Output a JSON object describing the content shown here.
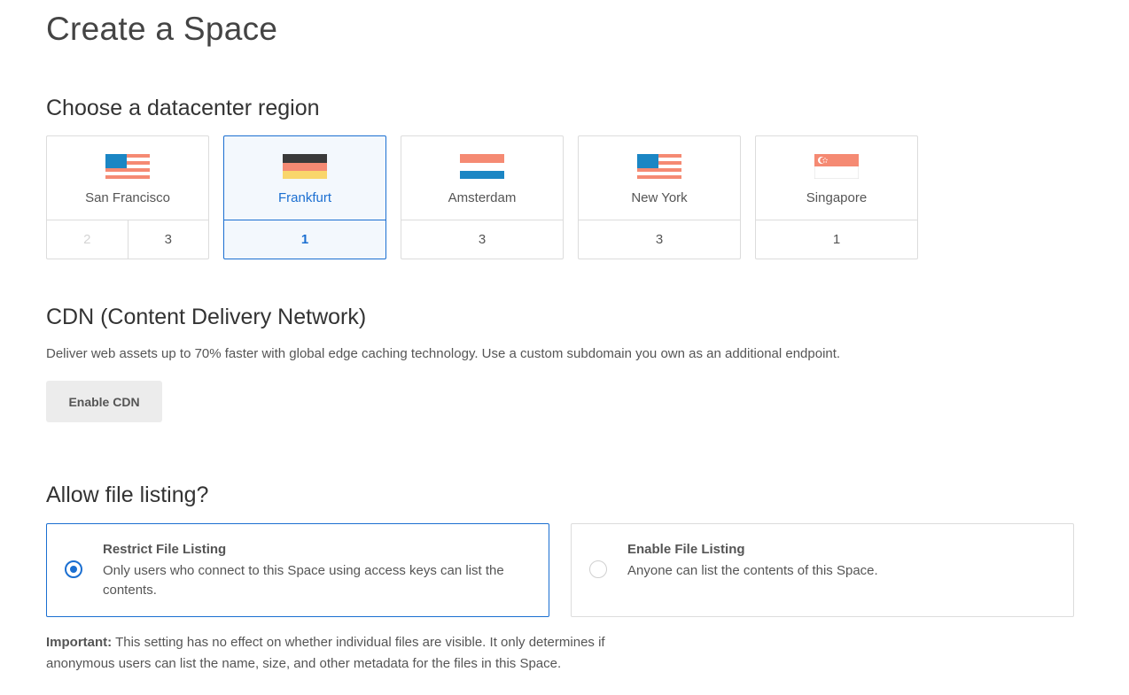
{
  "page_title": "Create a Space",
  "region_section": {
    "heading": "Choose a datacenter region",
    "regions": [
      {
        "name": "San Francisco",
        "flag": "us-flag-icon",
        "datacenters": [
          {
            "label": "2",
            "disabled": true
          },
          {
            "label": "3",
            "disabled": false
          }
        ],
        "selected": false
      },
      {
        "name": "Frankfurt",
        "flag": "germany-flag-icon",
        "datacenters": [
          {
            "label": "1",
            "disabled": false
          }
        ],
        "selected": true
      },
      {
        "name": "Amsterdam",
        "flag": "netherlands-flag-icon",
        "datacenters": [
          {
            "label": "3",
            "disabled": false
          }
        ],
        "selected": false
      },
      {
        "name": "New York",
        "flag": "us-flag-icon",
        "datacenters": [
          {
            "label": "3",
            "disabled": false
          }
        ],
        "selected": false
      },
      {
        "name": "Singapore",
        "flag": "singapore-flag-icon",
        "datacenters": [
          {
            "label": "1",
            "disabled": false
          }
        ],
        "selected": false
      }
    ]
  },
  "cdn_section": {
    "heading": "CDN (Content Delivery Network)",
    "description": "Deliver web assets up to 70% faster with global edge caching technology. Use a custom subdomain you own as an additional endpoint.",
    "button_label": "Enable CDN"
  },
  "listing_section": {
    "heading": "Allow file listing?",
    "options": [
      {
        "title": "Restrict File Listing",
        "description": "Only users who connect to this Space using access keys can list the contents.",
        "selected": true
      },
      {
        "title": "Enable File Listing",
        "description": "Anyone can list the contents of this Space.",
        "selected": false
      }
    ],
    "note_label": "Important:",
    "note_text": " This setting has no effect on whether individual files are visible. It only determines if anonymous users can list the name, size, and other metadata for the files in this Space."
  },
  "colors": {
    "accent": "#1b6fd1",
    "flag_salmon": "#f58a73",
    "flag_blue": "#1b86c4",
    "flag_dark": "#3a3a3a",
    "flag_yellow": "#f9d66b"
  }
}
